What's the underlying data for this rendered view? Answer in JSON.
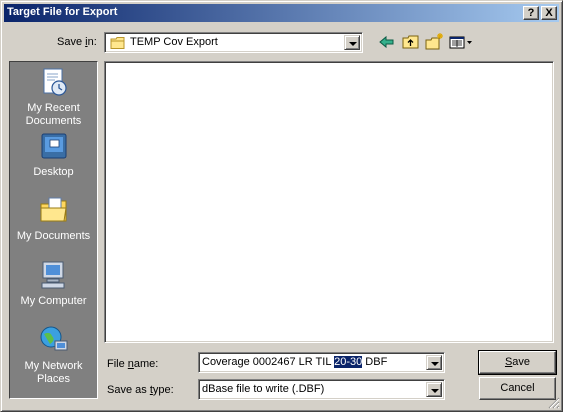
{
  "window": {
    "title": "Target File for Export",
    "help_label": "?",
    "close_label": "X"
  },
  "save_in": {
    "label_pre": "Save ",
    "label_key": "i",
    "label_post": "n:",
    "value": "TEMP Cov Export"
  },
  "toolbar": {
    "back_icon": "back-arrow-icon",
    "up_icon": "up-folder-icon",
    "new_folder_icon": "new-folder-icon",
    "view_menu_icon": "view-menu-icon"
  },
  "places": [
    {
      "label_line1": "My Recent",
      "label_line2": "Documents",
      "icon": "recent-documents-icon"
    },
    {
      "label_line1": "Desktop",
      "label_line2": "",
      "icon": "desktop-icon"
    },
    {
      "label_line1": "My Documents",
      "label_line2": "",
      "icon": "my-documents-icon"
    },
    {
      "label_line1": "My Computer",
      "label_line2": "",
      "icon": "my-computer-icon"
    },
    {
      "label_line1": "My Network",
      "label_line2": "Places",
      "icon": "network-places-icon"
    }
  ],
  "file_name": {
    "label_pre": "File ",
    "label_key": "n",
    "label_post": "ame:",
    "value_before": "Coverage 0002467 LR TIL ",
    "value_selected": "20-30",
    "value_after": " DBF"
  },
  "save_as_type": {
    "label_pre": "Save as ",
    "label_key": "t",
    "label_post": "ype:",
    "value": "dBase file to write (.DBF)"
  },
  "buttons": {
    "save_key": "S",
    "save_rest": "ave",
    "cancel": "Cancel"
  },
  "colors": {
    "title_gradient_start": "#0a246a",
    "title_gradient_end": "#a6caf0",
    "dialog_face": "#d4d0c8",
    "places_bar": "#808080",
    "selection": "#0a246a"
  }
}
